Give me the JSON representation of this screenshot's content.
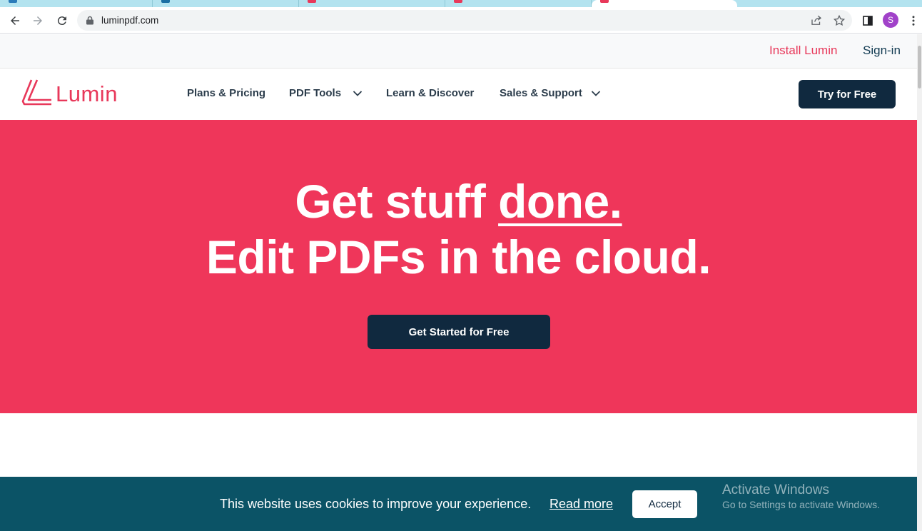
{
  "browser": {
    "url": "luminpdf.com",
    "profile_initial": "S",
    "tab_favicon_colors": [
      "#2b7bb9",
      "#1a6fa3",
      "#e8385a",
      "#e8385a",
      "#e8385a"
    ]
  },
  "site": {
    "brand": "Lumin",
    "brand_color": "#e8385a",
    "utility_links": {
      "install": "Install Lumin",
      "signin": "Sign-in"
    },
    "nav": {
      "plans": "Plans & Pricing",
      "pdf_tools": "PDF Tools",
      "learn": "Learn & Discover",
      "sales": "Sales & Support",
      "try_button": "Try for Free"
    },
    "hero": {
      "line1_prefix": "Get stuff ",
      "line1_emph": "done.",
      "line2": "Edit PDFs in the cloud.",
      "cta": "Get Started for Free",
      "background": "#ef365a"
    },
    "cookie_banner": {
      "message": "This website uses cookies to improve your experience.",
      "read_more": "Read more",
      "accept": "Accept",
      "background": "#0b5366"
    }
  },
  "os_watermark": {
    "title": "Activate Windows",
    "subtitle": "Go to Settings to activate Windows."
  }
}
